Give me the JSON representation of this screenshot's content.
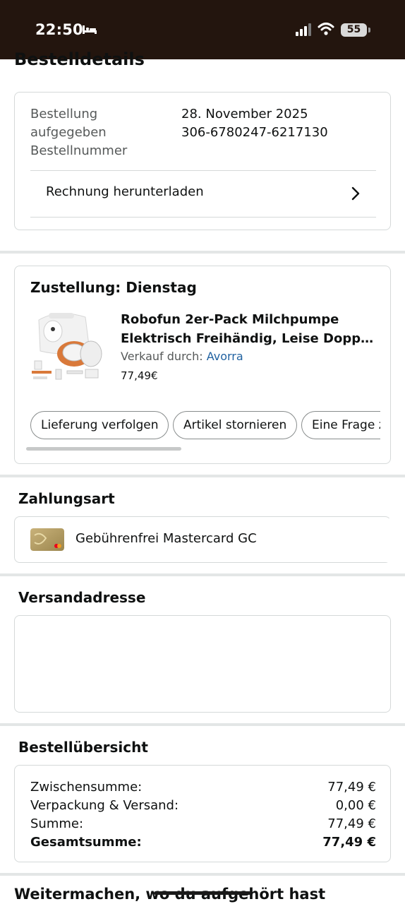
{
  "status_bar": {
    "time": "22:50",
    "battery": "55",
    "icons": [
      "sleep-icon",
      "signal-icon",
      "wifi-icon",
      "battery-icon"
    ]
  },
  "page_title": "Bestelldetails",
  "order": {
    "placed_label": "Bestellung aufgegeben",
    "placed_value": "28. November 2025",
    "number_label": "Bestellnummer",
    "number_value": "306-6780247-6217130",
    "invoice_label": "Rechnung herunterladen"
  },
  "delivery": {
    "title": "Zustellung: Dienstag",
    "product_title_line1": "Robofun 2er-Pack Milchpumpe",
    "product_title_line2": "Elektrisch Freihändig, Leise Doppel...",
    "seller_label": "Verkauf durch:",
    "seller_name": "Avorra",
    "price": "77,49€",
    "actions": [
      "Lieferung verfolgen",
      "Artikel stornieren",
      "Eine Frage z"
    ]
  },
  "payment": {
    "title": "Zahlungsart",
    "method": "Gebührenfrei Mastercard GC",
    "card_icon": "mastercard-gold-card-icon"
  },
  "shipping": {
    "title": "Versandadresse"
  },
  "summary": {
    "title": "Bestellübersicht",
    "rows": [
      {
        "label": "Zwischensumme:",
        "value": "77,49 €"
      },
      {
        "label": "Verpackung & Versand:",
        "value": "0,00 €"
      },
      {
        "label": "Summe:",
        "value": "77,49 €"
      },
      {
        "label": "Gesamtsumme:",
        "value": "77,49 €"
      }
    ]
  },
  "continue_title": "Weitermachen, wo du aufgehört hast",
  "colors": {
    "status_bar_bg": "#23150e",
    "link": "#2162a1",
    "border": "#d5d9d9",
    "secondary_text": "#565959"
  }
}
